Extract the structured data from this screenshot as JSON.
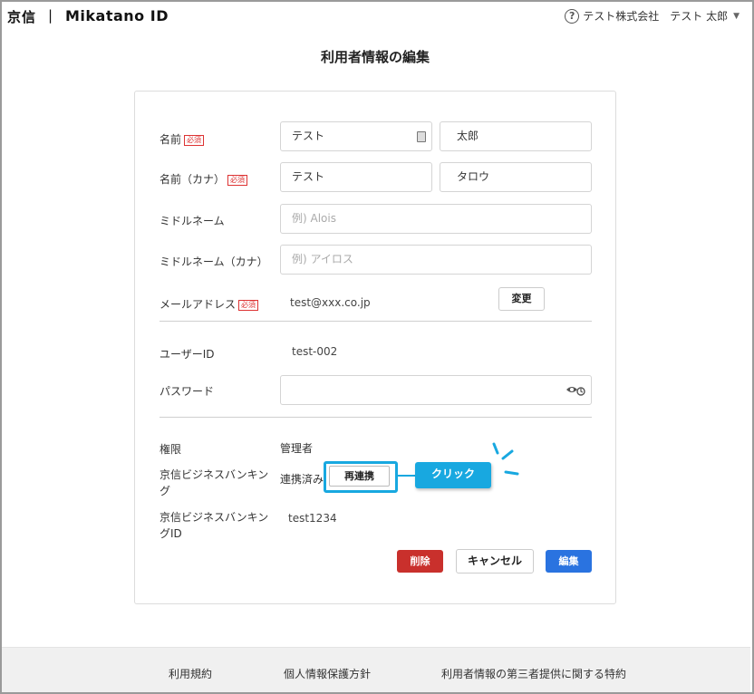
{
  "header": {
    "logo_brand": "京信",
    "logo_separator": "|",
    "logo_product": "Mikatano ID",
    "company": "テスト株式会社",
    "user": "テスト 太郎"
  },
  "page_title": "利用者情報の編集",
  "required_badge": "必須",
  "form": {
    "name_label": "名前",
    "last_name": "テスト",
    "first_name": "太郎",
    "kana_label": "名前（カナ）",
    "last_name_kana": "テスト",
    "first_name_kana": "タロウ",
    "middle_label": "ミドルネーム",
    "middle_placeholder": "例) Alois",
    "middle_kana_label": "ミドルネーム（カナ）",
    "middle_kana_placeholder": "例) アイロス",
    "email_label": "メールアドレス",
    "email_value": "test@xxx.co.jp",
    "change_button": "変更",
    "userid_label": "ユーザーID",
    "userid_value": "test-002",
    "password_label": "パスワード",
    "role_label": "権限",
    "role_value": "管理者",
    "bank_label_line1": "京信ビジネスバンキン",
    "bank_label_line2": "グ",
    "bank_status": "連携済み",
    "relink_button": "再連携",
    "bankid_label_line1": "京信ビジネスバンキン",
    "bankid_label_line2": "グID",
    "bankid_value": "test1234"
  },
  "callout": {
    "text": "クリック",
    "color": "#18a8e0"
  },
  "actions": {
    "delete": "削除",
    "cancel": "キャンセル",
    "edit": "編集"
  },
  "colors": {
    "delete": "#c9302c",
    "edit": "#2a73e0",
    "required": "#dd3333"
  },
  "footer": {
    "terms": "利用規約",
    "privacy": "個人情報保護方針",
    "third_party": "利用者情報の第三者提供に関する特約"
  }
}
